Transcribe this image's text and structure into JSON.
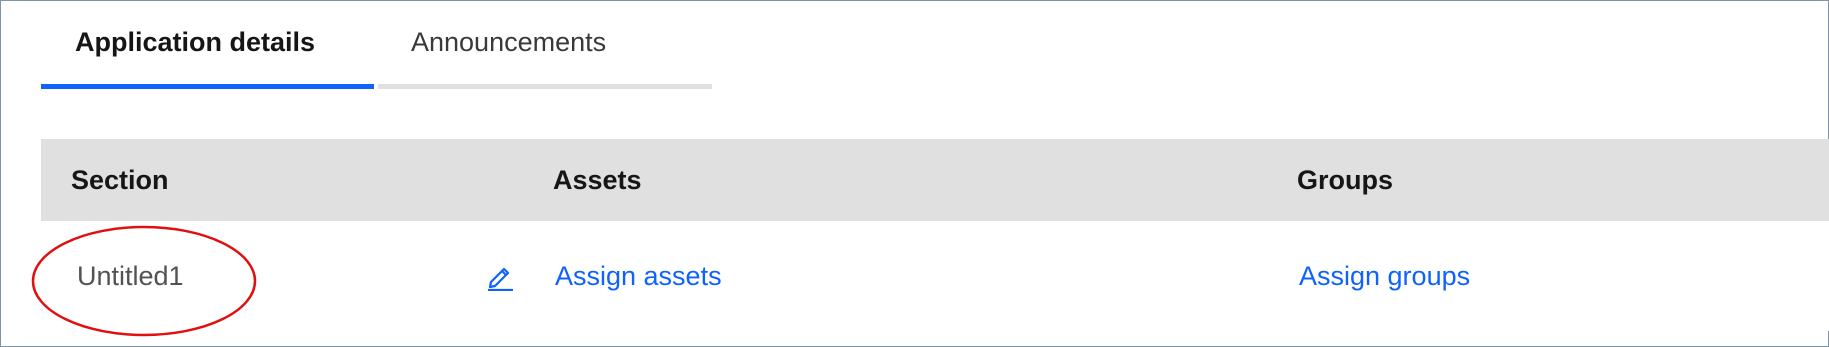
{
  "tabs": [
    {
      "label": "Application details",
      "active": true
    },
    {
      "label": "Announcements",
      "active": false
    }
  ],
  "table": {
    "headers": {
      "section": "Section",
      "assets": "Assets",
      "groups": "Groups"
    },
    "rows": [
      {
        "section": "Untitled1",
        "assets_link": "Assign assets",
        "groups_link": "Assign groups"
      }
    ]
  },
  "icons": {
    "edit": "pencil-edit-icon"
  },
  "colors": {
    "accent": "#0f62fe",
    "header_bg": "#e0e0e0",
    "annotation": "#e01010"
  }
}
